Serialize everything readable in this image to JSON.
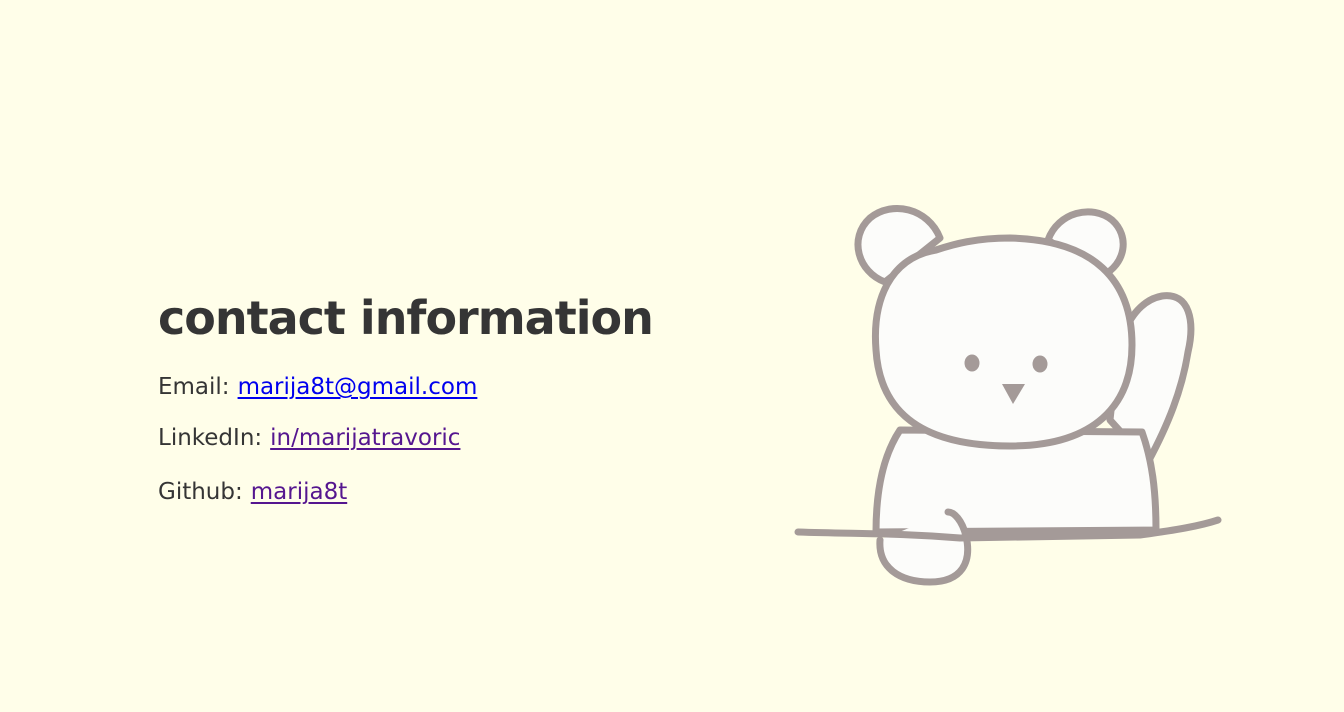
{
  "contact": {
    "title": "contact information",
    "email": {
      "label": "Email:",
      "link": "marija8t@gmail.com"
    },
    "linkedin": {
      "label": "LinkedIn:",
      "link": "in/marijatravoric"
    },
    "github": {
      "label": "Github:",
      "link": "marija8t"
    }
  },
  "colors": {
    "background": "#fffee9",
    "text": "#353535",
    "link_unvisited": "#0000ee",
    "link_visited": "#55168f",
    "bear_outline": "#a49a98",
    "bear_fill": "#fcfcfa"
  },
  "illustration": {
    "icon": "waving-bear-icon"
  }
}
